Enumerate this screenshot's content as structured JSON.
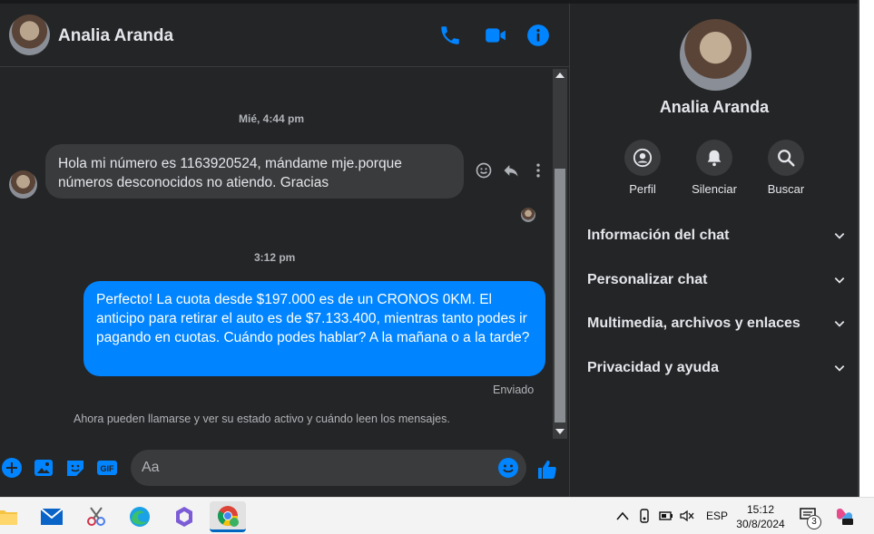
{
  "header": {
    "contact_name": "Analia Aranda",
    "icons": [
      "phone-icon",
      "video-call-icon",
      "info-icon"
    ]
  },
  "conversation": {
    "timestamp_1": "Mié, 4:44 pm",
    "incoming_message": "Hola mi número es 1163920524, mándame mje.porque números desconocidos no atiendo. Gracias",
    "timestamp_2": "3:12 pm",
    "outgoing_message": "Perfecto! La cuota desde $197.000 es de un CRONOS 0KM. El anticipo para retirar el auto es de $7.133.400, mientras tanto podes ir pagando en cuotas. Cuándo podes hablar? A la mañana o a la tarde?",
    "outgoing_status": "Enviado",
    "notice": "Ahora pueden llamarse y ver su estado activo y cuándo leen los mensajes."
  },
  "composer": {
    "placeholder": "Aa"
  },
  "info_panel": {
    "name": "Analia Aranda",
    "actions": [
      {
        "label": "Perfil",
        "icon": "profile-icon"
      },
      {
        "label": "Silenciar",
        "icon": "bell-icon"
      },
      {
        "label": "Buscar",
        "icon": "search-icon"
      }
    ],
    "sections": [
      "Información del chat",
      "Personalizar chat",
      "Multimedia, archivos y enlaces",
      "Privacidad y ayuda"
    ]
  },
  "taskbar": {
    "language": "ESP",
    "time": "15:12",
    "date": "30/8/2024",
    "notification_count": "3"
  },
  "colors": {
    "accent": "#0084ff",
    "background": "#242526",
    "bubble_incoming": "#3a3b3c"
  }
}
